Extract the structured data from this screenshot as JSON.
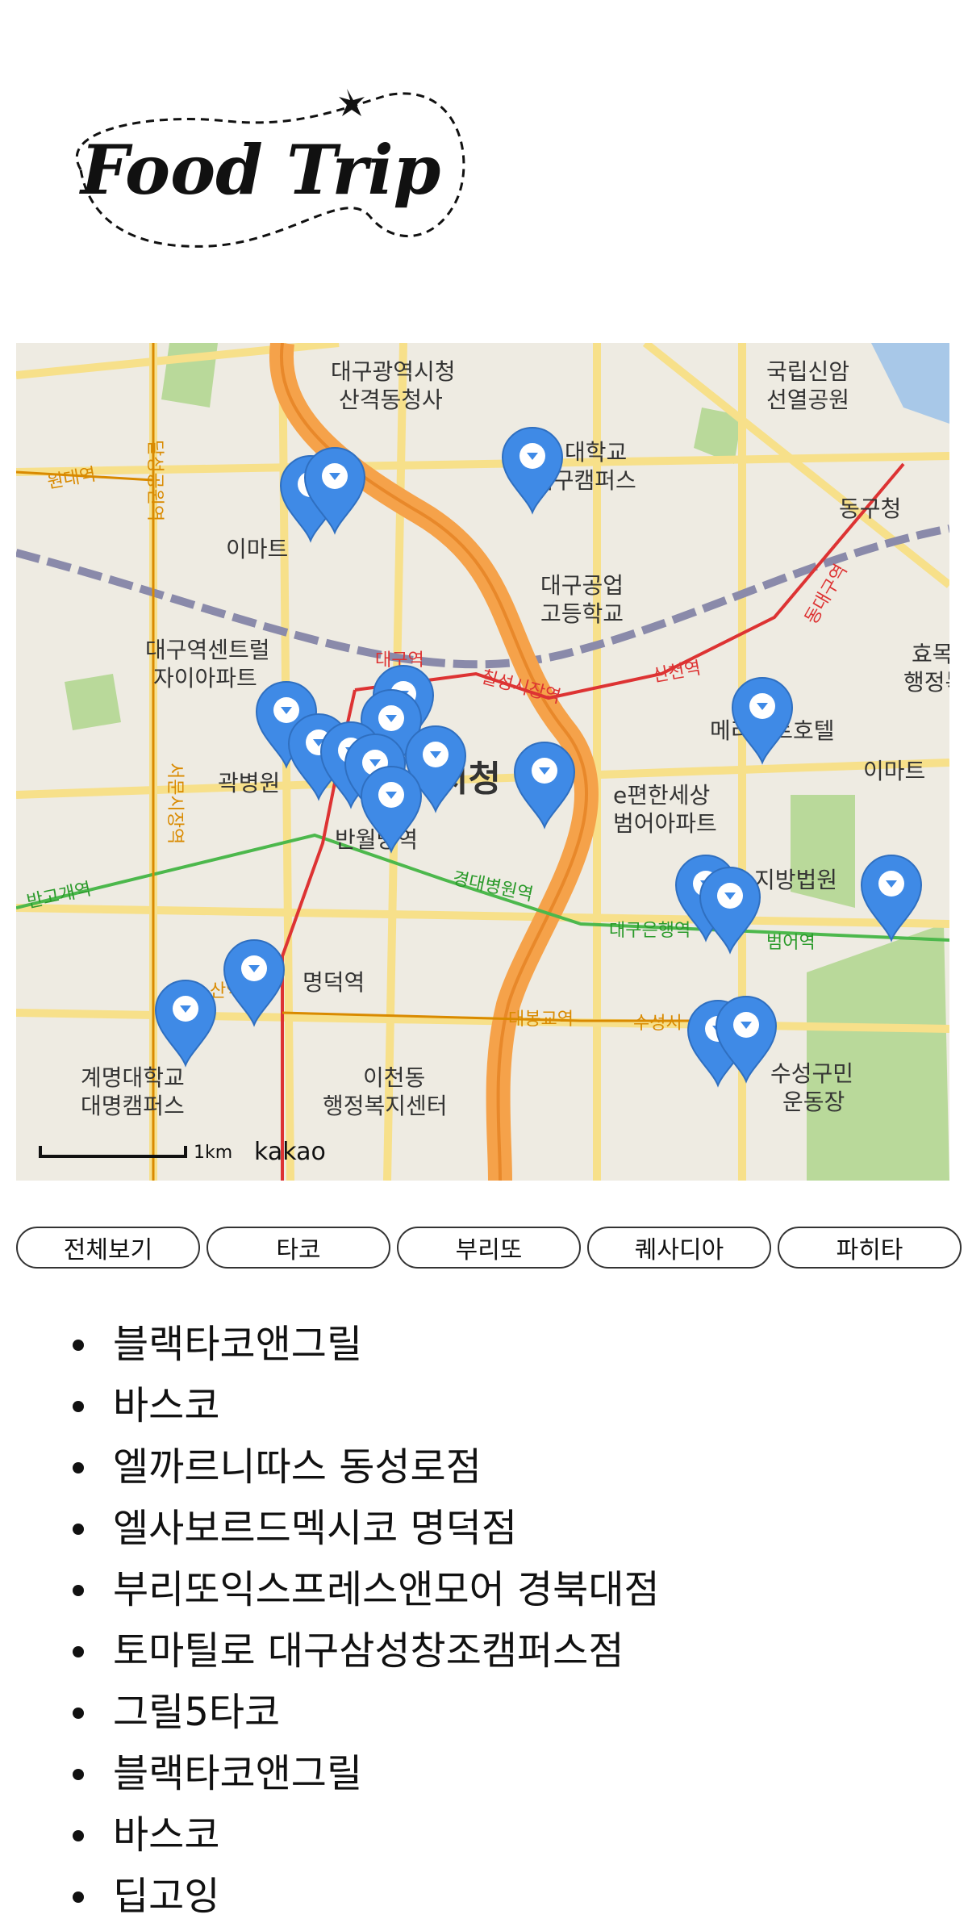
{
  "logo": {
    "text": "Food Trip"
  },
  "map": {
    "attribution": "kakao",
    "scale_label": "1km",
    "labels": [
      "대구광역시청",
      "산격동청사",
      "국립신암",
      "선열공원",
      "대학교",
      "대구캠퍼스",
      "동구청",
      "이마트",
      "대구공업",
      "고등학교",
      "대구역센트럴",
      "자이아파트",
      "대구역",
      "칠성시장역",
      "신천역",
      "동대구역",
      "메리어트호텔",
      "이마트",
      "효목",
      "행정복지",
      "곽병원",
      "시청",
      "e편한세상",
      "범어아파트",
      "반월당역",
      "반고개역",
      "서문시장역",
      "경대병원역",
      "대구은행역",
      "범어역",
      "지방법원",
      "명덕역",
      "산역",
      "대봉교역",
      "수성시",
      "이천동",
      "행정복지센터",
      "계명대학교",
      "대명캠퍼스",
      "수성구민",
      "운동장",
      "원대역",
      "달성공원역"
    ],
    "pin_icon": "map-marker-icon"
  },
  "categories": [
    "전체보기",
    "타코",
    "부리또",
    "퀘사디아",
    "파히타"
  ],
  "restaurants": [
    "블랙타코앤그릴",
    "바스코",
    "엘까르니따스 동성로점",
    "엘사보르드멕시코 명덕점",
    "부리또익스프레스앤모어 경북대점",
    "토마틸로 대구삼성창조캠퍼스점",
    "그릴5타코",
    "블랙타코앤그릴",
    "바스코",
    "딥고잉"
  ],
  "colors": {
    "pin": "#3f8ae6",
    "road_main": "#f5a24a",
    "road_yellow": "#f7e08a",
    "water": "#a8c8e8",
    "park": "#b9d99a"
  }
}
